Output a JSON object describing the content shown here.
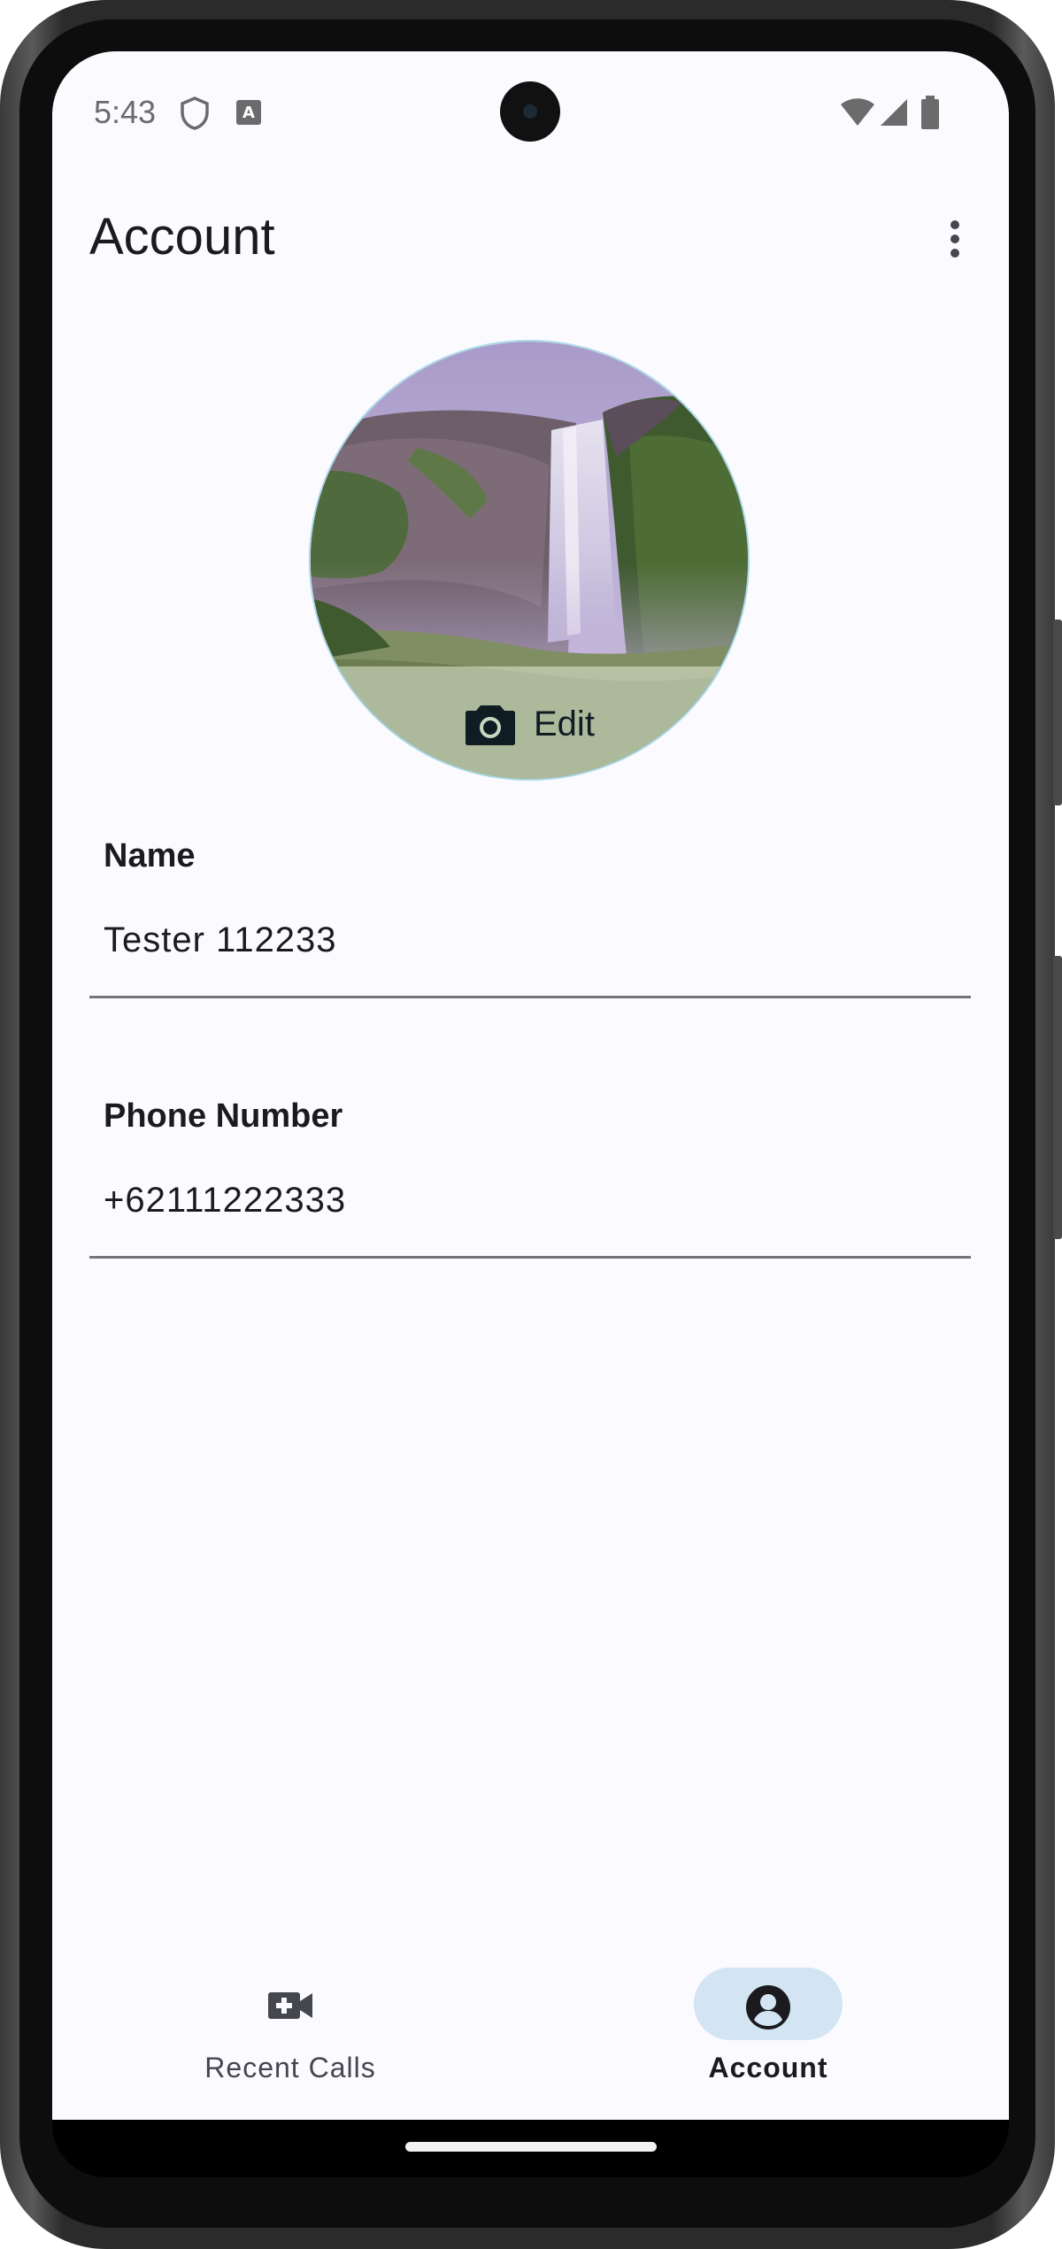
{
  "status_bar": {
    "time": "5:43"
  },
  "app_bar": {
    "title": "Account"
  },
  "avatar": {
    "edit_label": "Edit"
  },
  "fields": {
    "name": {
      "label": "Name",
      "value": "Tester 112233"
    },
    "phone": {
      "label": "Phone Number",
      "value": "+62111222333"
    }
  },
  "bottom_nav": {
    "items": [
      {
        "label": "Recent Calls",
        "icon": "video-call-icon",
        "active": false
      },
      {
        "label": "Account",
        "icon": "account-circle-icon",
        "active": true
      }
    ]
  },
  "colors": {
    "screen_bg": "#fbfaff",
    "active_pill": "#d3e4f3",
    "text_primary": "#1b1b1f",
    "avatar_border": "#a9d8e6"
  }
}
